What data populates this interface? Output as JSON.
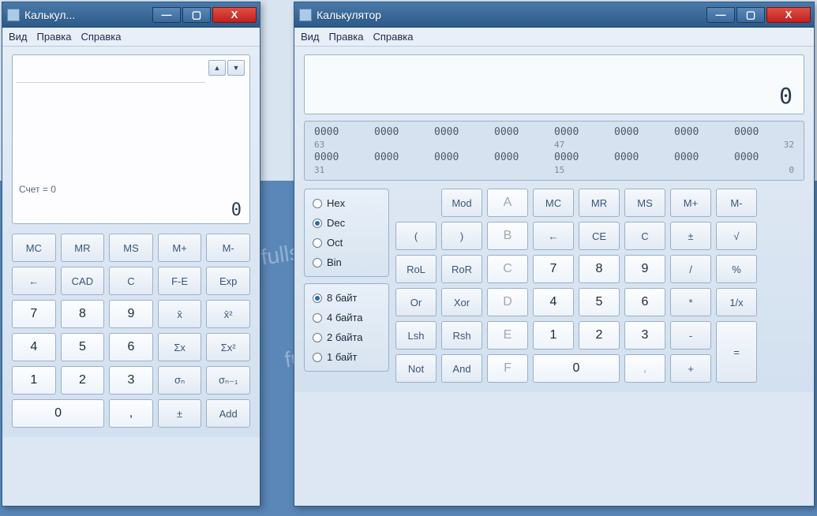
{
  "win1": {
    "title": "Калькул...",
    "menu": [
      "Вид",
      "Правка",
      "Справка"
    ],
    "count_label": "Счет = 0",
    "display": "0",
    "rows": [
      [
        "MC",
        "MR",
        "MS",
        "M+",
        "M-"
      ],
      [
        "←",
        "CAD",
        "C",
        "F-E",
        "Exp"
      ],
      [
        "7",
        "8",
        "9",
        "x̄",
        "x̄²"
      ],
      [
        "4",
        "5",
        "6",
        "Σx",
        "Σx²"
      ],
      [
        "1",
        "2",
        "3",
        "σₙ",
        "σₙ₋₁"
      ],
      [
        "0",
        "0",
        ",",
        "±",
        "Add"
      ]
    ]
  },
  "win2": {
    "title": "Калькулятор",
    "menu": [
      "Вид",
      "Правка",
      "Справка"
    ],
    "display": "0",
    "bits": {
      "groups": [
        "0000",
        "0000",
        "0000",
        "0000",
        "0000",
        "0000",
        "0000",
        "0000"
      ],
      "labels_top": [
        "63",
        "",
        "",
        "",
        "47",
        "",
        "",
        "32"
      ],
      "groups2": [
        "0000",
        "0000",
        "0000",
        "0000",
        "0000",
        "0000",
        "0000",
        "0000"
      ],
      "labels_bot": [
        "31",
        "",
        "",
        "",
        "15",
        "",
        "",
        "0"
      ]
    },
    "radix": [
      {
        "label": "Hex",
        "checked": false
      },
      {
        "label": "Dec",
        "checked": true
      },
      {
        "label": "Oct",
        "checked": false
      },
      {
        "label": "Bin",
        "checked": false
      }
    ],
    "width": [
      {
        "label": "8 байт",
        "checked": true
      },
      {
        "label": "4 байта",
        "checked": false
      },
      {
        "label": "2 байта",
        "checked": false
      },
      {
        "label": "1 байт",
        "checked": false
      }
    ],
    "grid": [
      [
        "",
        "Mod",
        "A",
        "MC",
        "MR",
        "MS",
        "M+",
        "M-"
      ],
      [
        "(",
        ")",
        "B",
        "←",
        "CE",
        "C",
        "±",
        "√"
      ],
      [
        "RoL",
        "RoR",
        "C",
        "7",
        "8",
        "9",
        "/",
        "%"
      ],
      [
        "Or",
        "Xor",
        "D",
        "4",
        "5",
        "6",
        "*",
        "1/x"
      ],
      [
        "Lsh",
        "Rsh",
        "E",
        "1",
        "2",
        "3",
        "-",
        "="
      ],
      [
        "Not",
        "And",
        "F",
        "0",
        "0",
        ",",
        "+",
        "="
      ]
    ]
  }
}
